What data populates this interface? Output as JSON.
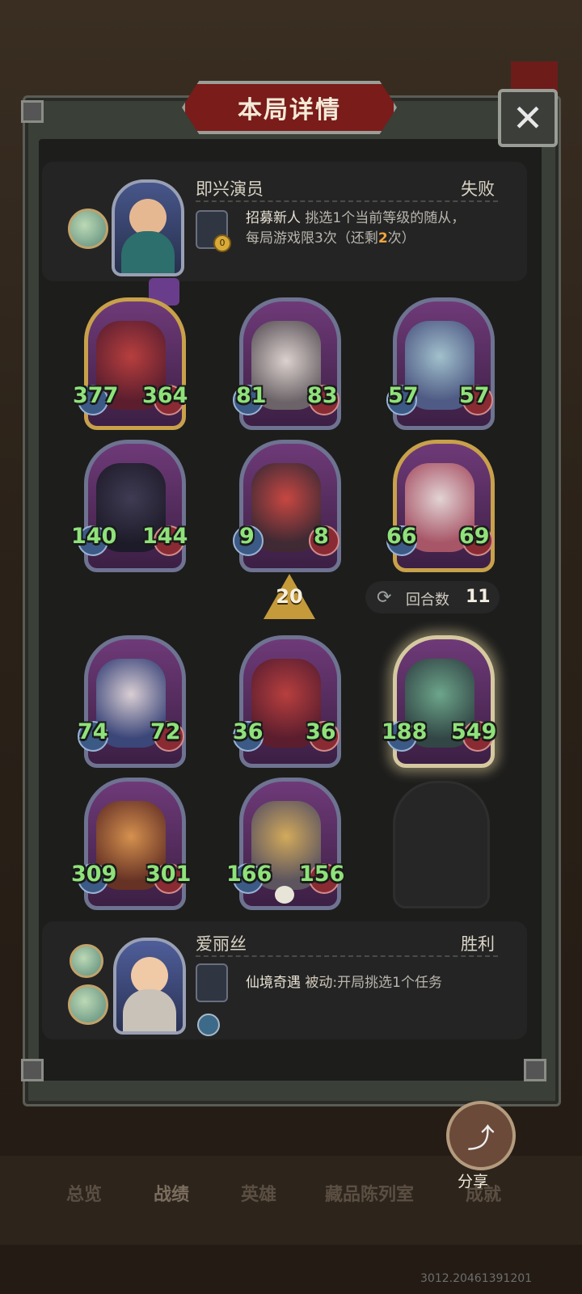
{
  "header": {
    "title": "本局详情",
    "close_icon": "close-icon"
  },
  "top_player": {
    "hero_name": "即兴演员",
    "result": "失败",
    "ability_name": "招募新人",
    "ability_text_1": "挑选1个当前等级的随从，",
    "ability_text_2a": "每局游戏限3次（还剩",
    "ability_remaining": "2",
    "ability_text_2b": "次）",
    "coin_cost": "0"
  },
  "board": {
    "level": "20",
    "turns_label": "回合数",
    "turns_value": "11",
    "minions": [
      {
        "atk": "377",
        "hp": "364"
      },
      {
        "atk": "81",
        "hp": "83"
      },
      {
        "atk": "57",
        "hp": "57"
      },
      {
        "atk": "140",
        "hp": "144"
      },
      {
        "atk": "9",
        "hp": "8"
      },
      {
        "atk": "66",
        "hp": "69"
      },
      {
        "atk": "74",
        "hp": "72"
      },
      {
        "atk": "36",
        "hp": "36"
      },
      {
        "atk": "188",
        "hp": "549"
      },
      {
        "atk": "309",
        "hp": "301"
      },
      {
        "atk": "166",
        "hp": "156"
      }
    ]
  },
  "bottom_player": {
    "hero_name": "爱丽丝",
    "result": "胜利",
    "ability_name": "仙境奇遇",
    "ability_tag": "被动",
    "ability_text": ":开局挑选1个任务"
  },
  "share": {
    "label": "分享"
  },
  "tabs": [
    "总览",
    "战绩",
    "英雄",
    "藏品陈列室",
    "成就"
  ],
  "build_id": "3012.20461391201"
}
